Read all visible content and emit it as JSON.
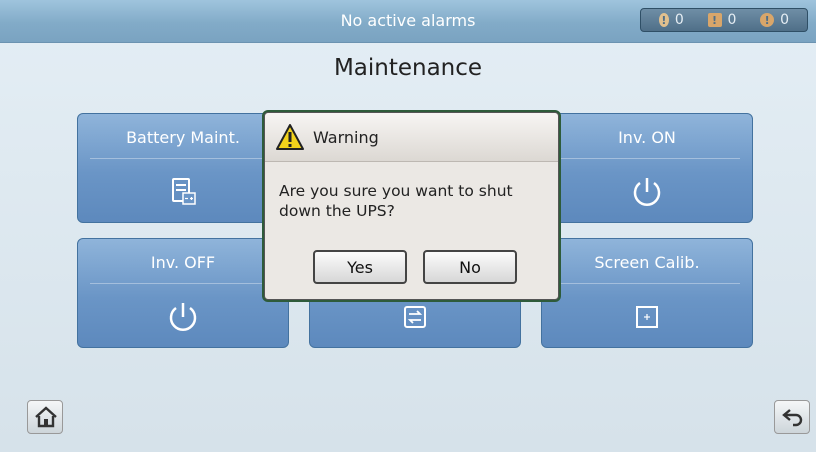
{
  "status_bar": {
    "alarm_text": "No active alarms",
    "counts": {
      "critical": "0",
      "major": "0",
      "minor": "0"
    }
  },
  "page": {
    "title": "Maintenance"
  },
  "tiles": [
    {
      "label": "Battery Maint.",
      "icon": "battery-maintenance-icon"
    },
    {
      "label": "Inv. ON",
      "icon": "power-icon"
    },
    {
      "label": "Inv. OFF",
      "icon": "power-icon"
    },
    {
      "label": "",
      "icon": "transfer-icon"
    },
    {
      "label": "Screen Calib.",
      "icon": "calibration-icon"
    }
  ],
  "dialog": {
    "title": "Warning",
    "message": "Are you sure you want to shut down the UPS?",
    "yes_label": "Yes",
    "no_label": "No"
  },
  "colors": {
    "accent": "#6a95c6",
    "warning": "#f2d21b",
    "alarm_icon": "#d9a66a"
  }
}
